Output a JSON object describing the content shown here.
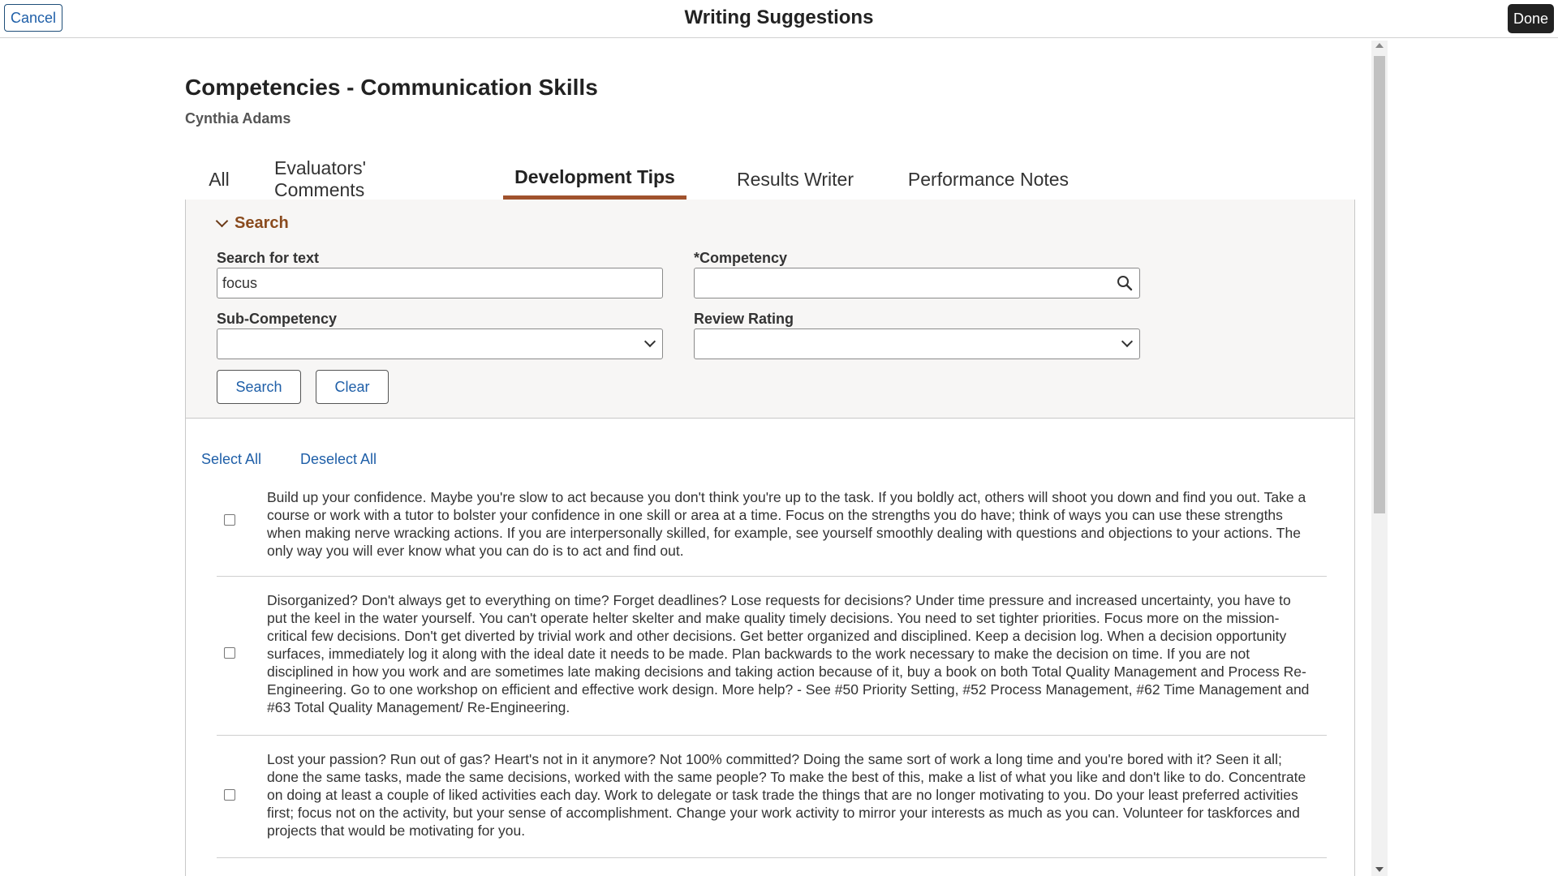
{
  "topbar": {
    "cancel_label": "Cancel",
    "title": "Writing Suggestions",
    "done_label": "Done"
  },
  "header": {
    "title": "Competencies - Communication Skills",
    "subtitle": "Cynthia Adams"
  },
  "tabs": [
    {
      "label": "All",
      "active": false
    },
    {
      "label": "Evaluators' Comments",
      "active": false
    },
    {
      "label": "Development Tips",
      "active": true
    },
    {
      "label": "Results Writer",
      "active": false
    },
    {
      "label": "Performance Notes",
      "active": false
    }
  ],
  "search": {
    "toggle_label": "Search",
    "text_label": "Search for text",
    "text_value": "focus",
    "competency_label": "*Competency",
    "competency_value": "",
    "subcompetency_label": "Sub-Competency",
    "subcompetency_value": "",
    "rating_label": "Review Rating",
    "rating_value": "",
    "search_button": "Search",
    "clear_button": "Clear"
  },
  "results": {
    "select_all": "Select All",
    "deselect_all": "Deselect All",
    "items": [
      {
        "checked": false,
        "text": "Build up your confidence. Maybe you're slow to act because you don't think you're up to the task. If you boldly act, others will shoot you down and find you out. Take a course or work with a tutor to bolster your confidence in one skill or area at a time. Focus on the strengths you do have; think of ways you can use these strengths when making nerve wracking actions. If you are interpersonally skilled, for example, see yourself smoothly dealing with questions and objections to your actions. The only way you will ever know what you can do is to act and find out."
      },
      {
        "checked": false,
        "text": "Disorganized? Don't always get to everything on time? Forget deadlines? Lose requests for decisions? Under time pressure and increased uncertainty, you have to put the keel in the water yourself. You can't operate helter skelter and make quality timely decisions. You need to set tighter priorities. Focus more on the mission-critical few decisions. Don't get diverted by trivial work and other decisions. Get better organized and disciplined. Keep a decision log. When a decision opportunity surfaces, immediately log it along with the ideal date it needs to be made. Plan backwards to the work necessary to make the decision on time. If you are not disciplined in how you work and are sometimes late making decisions and taking action because of it, buy a book on both Total Quality Management and Process Re-Engineering. Go to one workshop on efficient and effective work design. More help? - See #50 Priority Setting, #52 Process Management, #62 Time Management and #63 Total Quality Management/ Re-Engineering."
      },
      {
        "checked": false,
        "text": "Lost your passion? Run out of gas? Heart's not in it anymore? Not 100% committed? Doing the same sort of work a long time and you're bored with it? Seen it all; done the same tasks, made the same decisions, worked with the same people? To make the best of this, make a list of what you like and don't like to do. Concentrate on doing at least a couple of liked activities each day. Work to delegate or task trade the things that are no longer motivating to you. Do your least preferred activities first; focus not on the activity, but your sense of accomplishment. Change your work activity to mirror your interests as much as you can. Volunteer for taskforces and projects that would be motivating for you."
      }
    ]
  }
}
